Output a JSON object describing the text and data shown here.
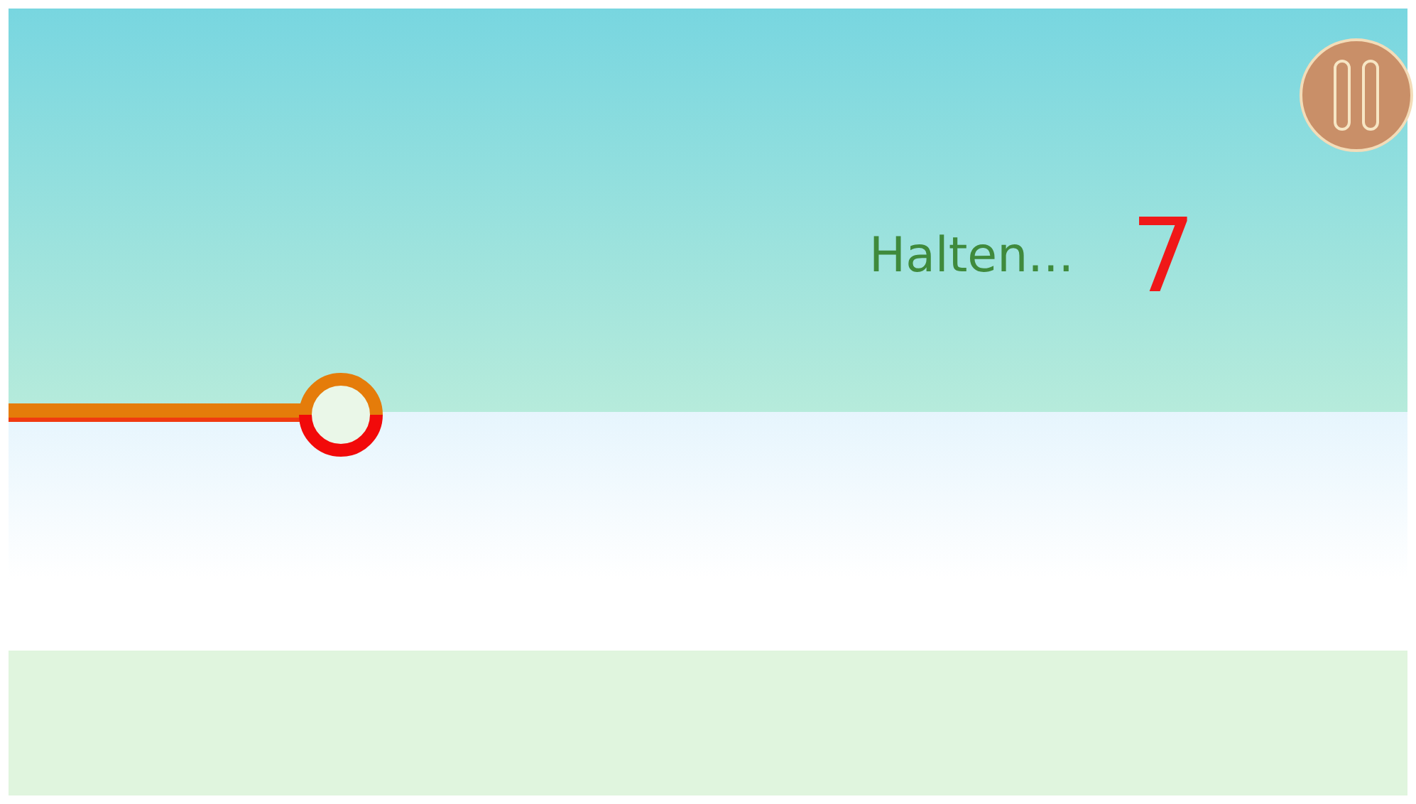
{
  "status": {
    "label": "Halten...",
    "count": "7"
  }
}
